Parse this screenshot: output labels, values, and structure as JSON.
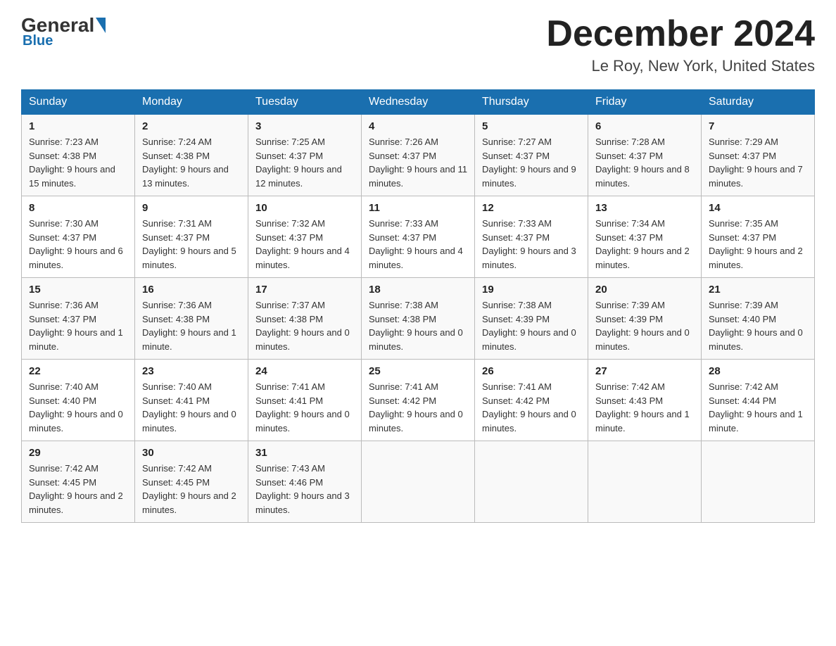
{
  "header": {
    "logo": {
      "general": "General",
      "blue": "Blue"
    },
    "title": "December 2024",
    "location": "Le Roy, New York, United States"
  },
  "calendar": {
    "days_of_week": [
      "Sunday",
      "Monday",
      "Tuesday",
      "Wednesday",
      "Thursday",
      "Friday",
      "Saturday"
    ],
    "weeks": [
      [
        {
          "day": "1",
          "sunrise": "7:23 AM",
          "sunset": "4:38 PM",
          "daylight": "9 hours and 15 minutes."
        },
        {
          "day": "2",
          "sunrise": "7:24 AM",
          "sunset": "4:38 PM",
          "daylight": "9 hours and 13 minutes."
        },
        {
          "day": "3",
          "sunrise": "7:25 AM",
          "sunset": "4:37 PM",
          "daylight": "9 hours and 12 minutes."
        },
        {
          "day": "4",
          "sunrise": "7:26 AM",
          "sunset": "4:37 PM",
          "daylight": "9 hours and 11 minutes."
        },
        {
          "day": "5",
          "sunrise": "7:27 AM",
          "sunset": "4:37 PM",
          "daylight": "9 hours and 9 minutes."
        },
        {
          "day": "6",
          "sunrise": "7:28 AM",
          "sunset": "4:37 PM",
          "daylight": "9 hours and 8 minutes."
        },
        {
          "day": "7",
          "sunrise": "7:29 AM",
          "sunset": "4:37 PM",
          "daylight": "9 hours and 7 minutes."
        }
      ],
      [
        {
          "day": "8",
          "sunrise": "7:30 AM",
          "sunset": "4:37 PM",
          "daylight": "9 hours and 6 minutes."
        },
        {
          "day": "9",
          "sunrise": "7:31 AM",
          "sunset": "4:37 PM",
          "daylight": "9 hours and 5 minutes."
        },
        {
          "day": "10",
          "sunrise": "7:32 AM",
          "sunset": "4:37 PM",
          "daylight": "9 hours and 4 minutes."
        },
        {
          "day": "11",
          "sunrise": "7:33 AM",
          "sunset": "4:37 PM",
          "daylight": "9 hours and 4 minutes."
        },
        {
          "day": "12",
          "sunrise": "7:33 AM",
          "sunset": "4:37 PM",
          "daylight": "9 hours and 3 minutes."
        },
        {
          "day": "13",
          "sunrise": "7:34 AM",
          "sunset": "4:37 PM",
          "daylight": "9 hours and 2 minutes."
        },
        {
          "day": "14",
          "sunrise": "7:35 AM",
          "sunset": "4:37 PM",
          "daylight": "9 hours and 2 minutes."
        }
      ],
      [
        {
          "day": "15",
          "sunrise": "7:36 AM",
          "sunset": "4:37 PM",
          "daylight": "9 hours and 1 minute."
        },
        {
          "day": "16",
          "sunrise": "7:36 AM",
          "sunset": "4:38 PM",
          "daylight": "9 hours and 1 minute."
        },
        {
          "day": "17",
          "sunrise": "7:37 AM",
          "sunset": "4:38 PM",
          "daylight": "9 hours and 0 minutes."
        },
        {
          "day": "18",
          "sunrise": "7:38 AM",
          "sunset": "4:38 PM",
          "daylight": "9 hours and 0 minutes."
        },
        {
          "day": "19",
          "sunrise": "7:38 AM",
          "sunset": "4:39 PM",
          "daylight": "9 hours and 0 minutes."
        },
        {
          "day": "20",
          "sunrise": "7:39 AM",
          "sunset": "4:39 PM",
          "daylight": "9 hours and 0 minutes."
        },
        {
          "day": "21",
          "sunrise": "7:39 AM",
          "sunset": "4:40 PM",
          "daylight": "9 hours and 0 minutes."
        }
      ],
      [
        {
          "day": "22",
          "sunrise": "7:40 AM",
          "sunset": "4:40 PM",
          "daylight": "9 hours and 0 minutes."
        },
        {
          "day": "23",
          "sunrise": "7:40 AM",
          "sunset": "4:41 PM",
          "daylight": "9 hours and 0 minutes."
        },
        {
          "day": "24",
          "sunrise": "7:41 AM",
          "sunset": "4:41 PM",
          "daylight": "9 hours and 0 minutes."
        },
        {
          "day": "25",
          "sunrise": "7:41 AM",
          "sunset": "4:42 PM",
          "daylight": "9 hours and 0 minutes."
        },
        {
          "day": "26",
          "sunrise": "7:41 AM",
          "sunset": "4:42 PM",
          "daylight": "9 hours and 0 minutes."
        },
        {
          "day": "27",
          "sunrise": "7:42 AM",
          "sunset": "4:43 PM",
          "daylight": "9 hours and 1 minute."
        },
        {
          "day": "28",
          "sunrise": "7:42 AM",
          "sunset": "4:44 PM",
          "daylight": "9 hours and 1 minute."
        }
      ],
      [
        {
          "day": "29",
          "sunrise": "7:42 AM",
          "sunset": "4:45 PM",
          "daylight": "9 hours and 2 minutes."
        },
        {
          "day": "30",
          "sunrise": "7:42 AM",
          "sunset": "4:45 PM",
          "daylight": "9 hours and 2 minutes."
        },
        {
          "day": "31",
          "sunrise": "7:43 AM",
          "sunset": "4:46 PM",
          "daylight": "9 hours and 3 minutes."
        },
        null,
        null,
        null,
        null
      ]
    ]
  }
}
